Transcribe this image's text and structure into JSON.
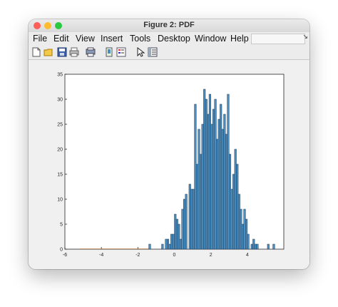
{
  "window": {
    "title": "Figure 2: PDF",
    "traffic_colors": [
      "#fe5f57",
      "#febc2e",
      "#28c840"
    ]
  },
  "menu": {
    "items": [
      "File",
      "Edit",
      "View",
      "Insert",
      "Tools",
      "Desktop",
      "Window",
      "Help"
    ]
  },
  "toolbar": {
    "icons": [
      "new-figure-icon",
      "open-file-icon",
      "save-icon",
      "print-icon",
      "print-preview-icon",
      "link-plot-icon",
      "insert-legend-icon",
      "edit-plot-arrow-icon",
      "property-inspector-icon"
    ]
  },
  "chart_data": {
    "type": "bar",
    "title": "",
    "xlabel": "",
    "ylabel": "",
    "xlim": [
      -6,
      6
    ],
    "ylim": [
      0,
      35
    ],
    "xticks": [
      -6,
      -4,
      -2,
      0,
      2,
      4
    ],
    "yticks": [
      0,
      5,
      10,
      15,
      20,
      25,
      30,
      35
    ],
    "bin_width": 0.1,
    "bar_color": "#4a8fbf",
    "edge_color": "#1f3550",
    "bins": [
      [
        -1.35,
        1
      ],
      [
        -0.65,
        1
      ],
      [
        -0.45,
        2
      ],
      [
        -0.35,
        2
      ],
      [
        -0.25,
        1
      ],
      [
        -0.15,
        3
      ],
      [
        -0.05,
        3
      ],
      [
        0.05,
        7
      ],
      [
        0.15,
        6
      ],
      [
        0.25,
        5
      ],
      [
        0.35,
        2
      ],
      [
        0.45,
        8
      ],
      [
        0.55,
        10
      ],
      [
        0.65,
        11
      ],
      [
        0.85,
        13
      ],
      [
        0.95,
        12
      ],
      [
        1.05,
        12
      ],
      [
        1.15,
        29
      ],
      [
        1.25,
        17
      ],
      [
        1.35,
        24
      ],
      [
        1.45,
        19
      ],
      [
        1.55,
        25
      ],
      [
        1.65,
        32
      ],
      [
        1.75,
        30
      ],
      [
        1.85,
        27
      ],
      [
        1.95,
        31
      ],
      [
        2.05,
        25
      ],
      [
        2.15,
        28
      ],
      [
        2.25,
        30
      ],
      [
        2.35,
        22
      ],
      [
        2.45,
        26
      ],
      [
        2.55,
        29
      ],
      [
        2.65,
        24
      ],
      [
        2.75,
        27
      ],
      [
        2.85,
        23
      ],
      [
        2.95,
        31
      ],
      [
        3.05,
        19
      ],
      [
        3.15,
        12
      ],
      [
        3.25,
        15
      ],
      [
        3.35,
        20
      ],
      [
        3.45,
        17
      ],
      [
        3.55,
        11
      ],
      [
        3.65,
        8
      ],
      [
        3.75,
        5
      ],
      [
        3.85,
        8
      ],
      [
        3.95,
        6
      ],
      [
        4.05,
        3
      ],
      [
        4.25,
        1
      ],
      [
        4.35,
        2
      ],
      [
        4.45,
        1
      ],
      [
        4.55,
        1
      ],
      [
        5.15,
        1
      ],
      [
        5.45,
        1
      ]
    ]
  }
}
